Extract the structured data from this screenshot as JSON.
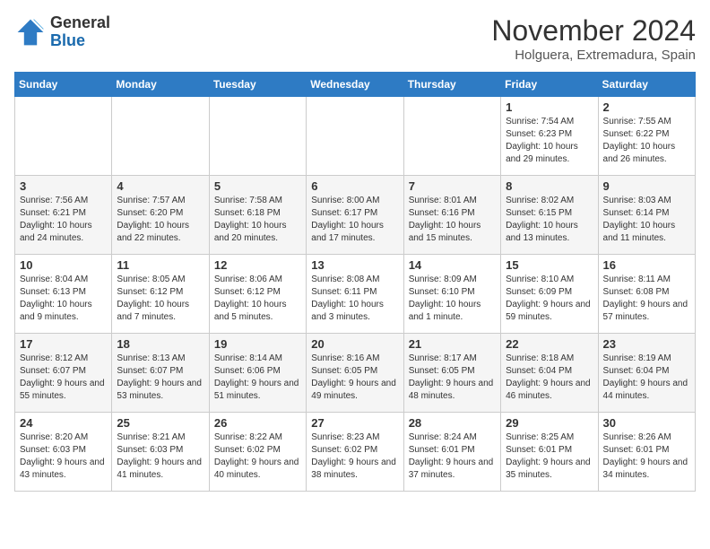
{
  "header": {
    "logo_general": "General",
    "logo_blue": "Blue",
    "month_title": "November 2024",
    "subtitle": "Holguera, Extremadura, Spain"
  },
  "columns": [
    "Sunday",
    "Monday",
    "Tuesday",
    "Wednesday",
    "Thursday",
    "Friday",
    "Saturday"
  ],
  "weeks": [
    [
      {
        "day": "",
        "info": ""
      },
      {
        "day": "",
        "info": ""
      },
      {
        "day": "",
        "info": ""
      },
      {
        "day": "",
        "info": ""
      },
      {
        "day": "",
        "info": ""
      },
      {
        "day": "1",
        "info": "Sunrise: 7:54 AM\nSunset: 6:23 PM\nDaylight: 10 hours and 29 minutes."
      },
      {
        "day": "2",
        "info": "Sunrise: 7:55 AM\nSunset: 6:22 PM\nDaylight: 10 hours and 26 minutes."
      }
    ],
    [
      {
        "day": "3",
        "info": "Sunrise: 7:56 AM\nSunset: 6:21 PM\nDaylight: 10 hours and 24 minutes."
      },
      {
        "day": "4",
        "info": "Sunrise: 7:57 AM\nSunset: 6:20 PM\nDaylight: 10 hours and 22 minutes."
      },
      {
        "day": "5",
        "info": "Sunrise: 7:58 AM\nSunset: 6:18 PM\nDaylight: 10 hours and 20 minutes."
      },
      {
        "day": "6",
        "info": "Sunrise: 8:00 AM\nSunset: 6:17 PM\nDaylight: 10 hours and 17 minutes."
      },
      {
        "day": "7",
        "info": "Sunrise: 8:01 AM\nSunset: 6:16 PM\nDaylight: 10 hours and 15 minutes."
      },
      {
        "day": "8",
        "info": "Sunrise: 8:02 AM\nSunset: 6:15 PM\nDaylight: 10 hours and 13 minutes."
      },
      {
        "day": "9",
        "info": "Sunrise: 8:03 AM\nSunset: 6:14 PM\nDaylight: 10 hours and 11 minutes."
      }
    ],
    [
      {
        "day": "10",
        "info": "Sunrise: 8:04 AM\nSunset: 6:13 PM\nDaylight: 10 hours and 9 minutes."
      },
      {
        "day": "11",
        "info": "Sunrise: 8:05 AM\nSunset: 6:12 PM\nDaylight: 10 hours and 7 minutes."
      },
      {
        "day": "12",
        "info": "Sunrise: 8:06 AM\nSunset: 6:12 PM\nDaylight: 10 hours and 5 minutes."
      },
      {
        "day": "13",
        "info": "Sunrise: 8:08 AM\nSunset: 6:11 PM\nDaylight: 10 hours and 3 minutes."
      },
      {
        "day": "14",
        "info": "Sunrise: 8:09 AM\nSunset: 6:10 PM\nDaylight: 10 hours and 1 minute."
      },
      {
        "day": "15",
        "info": "Sunrise: 8:10 AM\nSunset: 6:09 PM\nDaylight: 9 hours and 59 minutes."
      },
      {
        "day": "16",
        "info": "Sunrise: 8:11 AM\nSunset: 6:08 PM\nDaylight: 9 hours and 57 minutes."
      }
    ],
    [
      {
        "day": "17",
        "info": "Sunrise: 8:12 AM\nSunset: 6:07 PM\nDaylight: 9 hours and 55 minutes."
      },
      {
        "day": "18",
        "info": "Sunrise: 8:13 AM\nSunset: 6:07 PM\nDaylight: 9 hours and 53 minutes."
      },
      {
        "day": "19",
        "info": "Sunrise: 8:14 AM\nSunset: 6:06 PM\nDaylight: 9 hours and 51 minutes."
      },
      {
        "day": "20",
        "info": "Sunrise: 8:16 AM\nSunset: 6:05 PM\nDaylight: 9 hours and 49 minutes."
      },
      {
        "day": "21",
        "info": "Sunrise: 8:17 AM\nSunset: 6:05 PM\nDaylight: 9 hours and 48 minutes."
      },
      {
        "day": "22",
        "info": "Sunrise: 8:18 AM\nSunset: 6:04 PM\nDaylight: 9 hours and 46 minutes."
      },
      {
        "day": "23",
        "info": "Sunrise: 8:19 AM\nSunset: 6:04 PM\nDaylight: 9 hours and 44 minutes."
      }
    ],
    [
      {
        "day": "24",
        "info": "Sunrise: 8:20 AM\nSunset: 6:03 PM\nDaylight: 9 hours and 43 minutes."
      },
      {
        "day": "25",
        "info": "Sunrise: 8:21 AM\nSunset: 6:03 PM\nDaylight: 9 hours and 41 minutes."
      },
      {
        "day": "26",
        "info": "Sunrise: 8:22 AM\nSunset: 6:02 PM\nDaylight: 9 hours and 40 minutes."
      },
      {
        "day": "27",
        "info": "Sunrise: 8:23 AM\nSunset: 6:02 PM\nDaylight: 9 hours and 38 minutes."
      },
      {
        "day": "28",
        "info": "Sunrise: 8:24 AM\nSunset: 6:01 PM\nDaylight: 9 hours and 37 minutes."
      },
      {
        "day": "29",
        "info": "Sunrise: 8:25 AM\nSunset: 6:01 PM\nDaylight: 9 hours and 35 minutes."
      },
      {
        "day": "30",
        "info": "Sunrise: 8:26 AM\nSunset: 6:01 PM\nDaylight: 9 hours and 34 minutes."
      }
    ]
  ]
}
